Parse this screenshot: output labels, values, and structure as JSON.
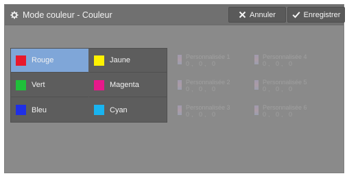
{
  "header": {
    "title": "Mode couleur - Couleur",
    "cancel_label": "Annuler",
    "save_label": "Enregistrer",
    "title_icon": "gear-icon",
    "cancel_icon": "close-icon",
    "save_icon": "check-icon"
  },
  "colors": [
    {
      "label": "Rouge",
      "swatch": "#e8192c",
      "selected": true
    },
    {
      "label": "Jaune",
      "swatch": "#fff200",
      "selected": false
    },
    {
      "label": "Vert",
      "swatch": "#1fbf3a",
      "selected": false
    },
    {
      "label": "Magenta",
      "swatch": "#e6198a",
      "selected": false
    },
    {
      "label": "Bleu",
      "swatch": "#1f2fe6",
      "selected": false
    },
    {
      "label": "Cyan",
      "swatch": "#19b4f0",
      "selected": false
    }
  ],
  "custom_colors": [
    {
      "label": "Personnalisée 1",
      "values": "0, 0, 0"
    },
    {
      "label": "Personnalisée 4",
      "values": "0, 0, 0"
    },
    {
      "label": "Personnalisée 2",
      "values": "0, 0, 0"
    },
    {
      "label": "Personnalisée 5",
      "values": "0, 0, 0"
    },
    {
      "label": "Personnalisée 3",
      "values": "0, 0, 0"
    },
    {
      "label": "Personnalisée 6",
      "values": "0, 0, 0"
    }
  ],
  "theme": {
    "selected_bg": "#7fa6d8",
    "header_bg": "#707070",
    "panel_bg": "#5d5d5d"
  }
}
